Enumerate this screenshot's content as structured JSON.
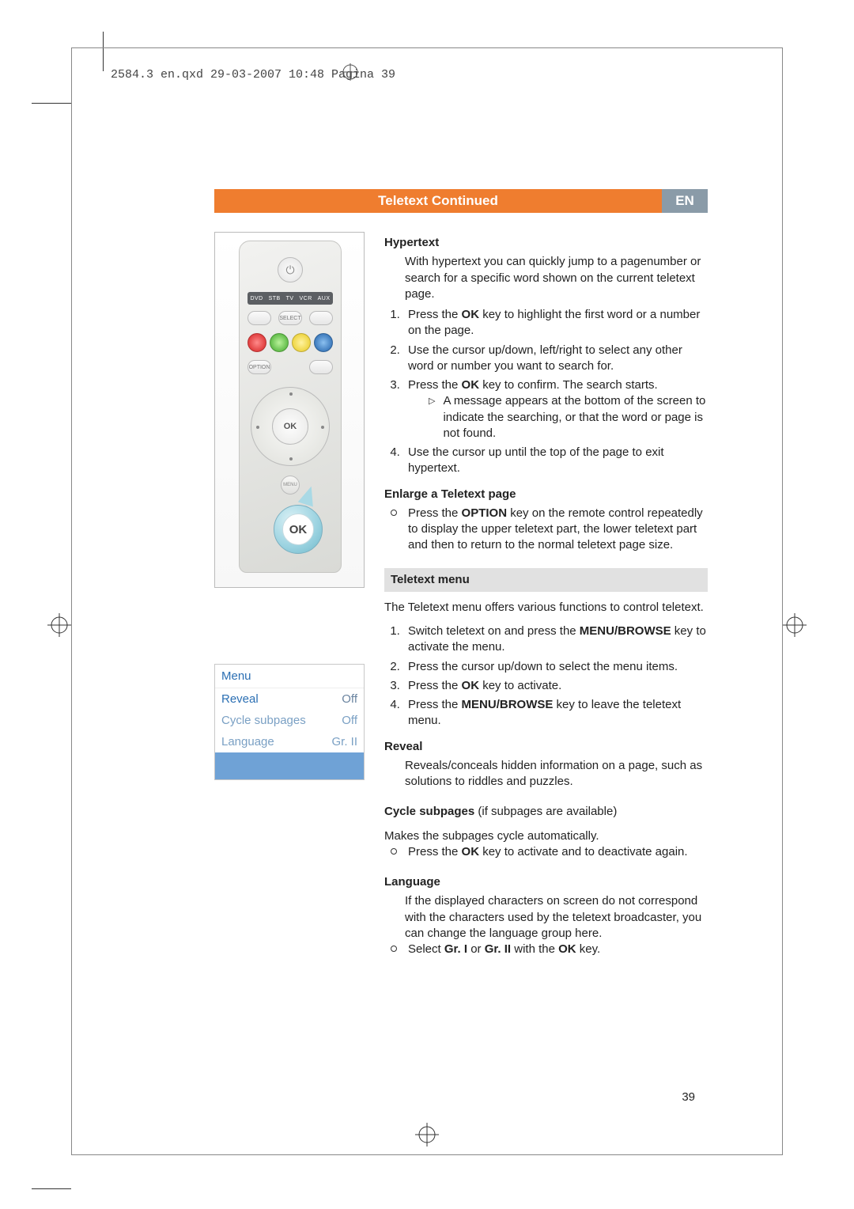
{
  "header_line": "2584.3 en.qxd  29-03-2007  10:48  Pagina 39",
  "title_bar": {
    "main": "Teletext  Continued",
    "lang": "EN"
  },
  "remote": {
    "devices": [
      "DVD",
      "STB",
      "TV",
      "VCR",
      "AUX"
    ],
    "select": "SELECT",
    "option": "OPTION",
    "ok": "OK",
    "menu": "MENU",
    "callout_ok": "OK"
  },
  "menu_panel": {
    "title": "Menu",
    "rows": [
      {
        "label": "Reveal",
        "value": "Off"
      },
      {
        "label": "Cycle subpages",
        "value": "Off"
      },
      {
        "label": "Language",
        "value": "Gr. II"
      }
    ]
  },
  "sections": {
    "hypertext": {
      "heading": "Hypertext",
      "intro": "With hypertext you can quickly jump to a pagenumber or search for a specific word shown on the current teletext page.",
      "steps": [
        "Press the <b>OK</b> key to highlight the first word or a number on the page.",
        "Use the cursor up/down, left/right to select any other word or number you want to search for.",
        "Press the <b>OK</b> key to confirm. The search starts.",
        "Use the cursor up until the top of the page to exit hypertext."
      ],
      "substep_after_3": "A message appears at the bottom of the screen to indicate the searching, or that the word or page is not found."
    },
    "enlarge": {
      "heading": "Enlarge a Teletext page",
      "bullet": "Press the <b>OPTION</b> key on the remote control repeatedly to display the upper teletext part, the lower teletext part and then to return to the normal teletext page size."
    },
    "teletext_menu": {
      "section_title": "Teletext menu",
      "intro": "The Teletext menu offers various functions to control teletext.",
      "steps": [
        "Switch teletext on and press the <b>MENU/BROWSE</b> key to activate the menu.",
        "Press the cursor up/down to select the menu items.",
        "Press the <b>OK</b> key to activate.",
        "Press the <b>MENU/BROWSE</b> key to leave the teletext menu."
      ]
    },
    "reveal": {
      "heading": "Reveal",
      "text": "Reveals/conceals hidden information on a page, such as solutions to riddles and puzzles."
    },
    "cycle": {
      "heading_html": "<b>Cycle subpages</b> (if subpages are available)",
      "text": "Makes the subpages cycle automatically.",
      "bullet": "Press the <b>OK</b> key to activate and to deactivate again."
    },
    "language": {
      "heading": "Language",
      "text": "If the displayed characters on screen do not correspond with the characters used by the teletext broadcaster, you can change the language group here.",
      "bullet": "Select <b>Gr. I</b> or <b>Gr. II</b> with the <b>OK</b> key."
    }
  },
  "page_number": "39"
}
